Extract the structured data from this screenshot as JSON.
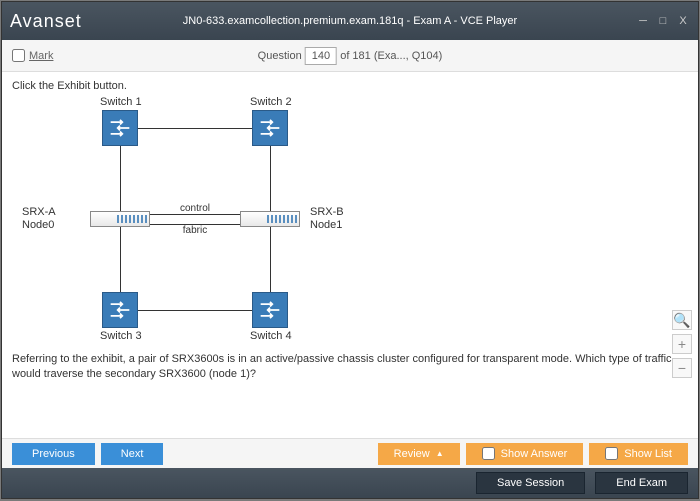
{
  "titlebar": {
    "logo": "Avanset",
    "title": "JN0-633.examcollection.premium.exam.181q - Exam A - VCE Player"
  },
  "qbar": {
    "mark_label": "Mark",
    "question_word": "Question",
    "question_num": "140",
    "of_text": "of 181 (Exa..., Q104)"
  },
  "content": {
    "exhibit_instruction": "Click the Exhibit button.",
    "labels": {
      "sw1": "Switch 1",
      "sw2": "Switch 2",
      "sw3": "Switch 3",
      "sw4": "Switch 4",
      "srxa": "SRX-A\nNode0",
      "srxb": "SRX-B\nNode1",
      "control": "control",
      "fabric": "fabric"
    },
    "question_text": "Referring to the exhibit, a pair of SRX3600s is in an active/passive chassis cluster configured for transparent mode. Which type of traffic would traverse the secondary SRX3600 (node 1)?"
  },
  "toolbar1": {
    "previous": "Previous",
    "next": "Next",
    "review": "Review",
    "show_answer": "Show Answer",
    "show_list": "Show List"
  },
  "toolbar2": {
    "save_session": "Save Session",
    "end_exam": "End Exam"
  }
}
